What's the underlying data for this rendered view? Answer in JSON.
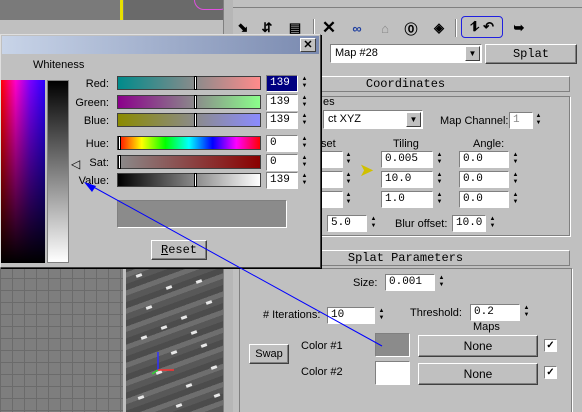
{
  "toolbar": {
    "icons": [
      "pick-material-icon",
      "put-material-icon",
      "assign-material-icon",
      "delete-icon",
      "make-unique-icon",
      "put-to-library-icon",
      "material-id-icon",
      "show-map-icon",
      "show-end-result-icon",
      "go-to-parent-icon",
      "go-forward-icon"
    ]
  },
  "map_bar": {
    "map_name": "Map #28",
    "map_type_button": "Splat"
  },
  "coordinates": {
    "title": "Coordinates",
    "source_partial": "es",
    "mapping_value": "ct XYZ",
    "map_channel_label": "Map Channel:",
    "map_channel_value": "1",
    "offset_header": "set",
    "tiling_header": "Tiling",
    "angle_header": "Angle:",
    "tiling": [
      "0.005",
      "10.0",
      "1.0"
    ],
    "angle": [
      "0.0",
      "0.0",
      "0.0"
    ],
    "blur_value": "5.0",
    "blur_offset_label": "Blur offset:",
    "blur_offset_value": "10.0"
  },
  "splat": {
    "title": "Splat Parameters",
    "size_label": "Size:",
    "size_value": "0.001",
    "iterations_label": "# Iterations:",
    "iterations_value": "10",
    "threshold_label": "Threshold:",
    "threshold_value": "0.2",
    "maps_label": "Maps",
    "swap_label": "Swap",
    "color1_label": "Color #1",
    "color2_label": "Color #2",
    "color1_hex": "#8b8b8b",
    "color2_hex": "#ffffff",
    "map1_label": "None",
    "map2_label": "None",
    "map1_enabled": true,
    "map2_enabled": true
  },
  "color_dialog": {
    "close_label": "✕",
    "whiteness_label": "Whiteness",
    "rows": [
      {
        "label": "Red:",
        "value": "139",
        "gradient": "linear-gradient(90deg,#008b8b,#ff8b8b)",
        "level": 0.545
      },
      {
        "label": "Green:",
        "value": "139",
        "gradient": "linear-gradient(90deg,#8b008b,#8bff8b)",
        "level": 0.545
      },
      {
        "label": "Blue:",
        "value": "139",
        "gradient": "linear-gradient(90deg,#8b8b00,#8b8bff)",
        "level": 0.545
      },
      {
        "label": "Hue:",
        "value": "0",
        "gradient": "linear-gradient(90deg,#f00,#ff0,#0f0,#0ff,#00f,#f0f,#f00)",
        "level": 0.0
      },
      {
        "label": "Sat:",
        "value": "0",
        "gradient": "linear-gradient(90deg,#8b8b8b,#8b0000)",
        "level": 0.0
      },
      {
        "label": "Value:",
        "value": "139",
        "gradient": "linear-gradient(90deg,#000,#fff)",
        "level": 0.545
      }
    ],
    "preview_hex": "#8b8b8b",
    "reset_label": "Reset",
    "reset_underline": "R",
    "reset_rest": "eset"
  }
}
